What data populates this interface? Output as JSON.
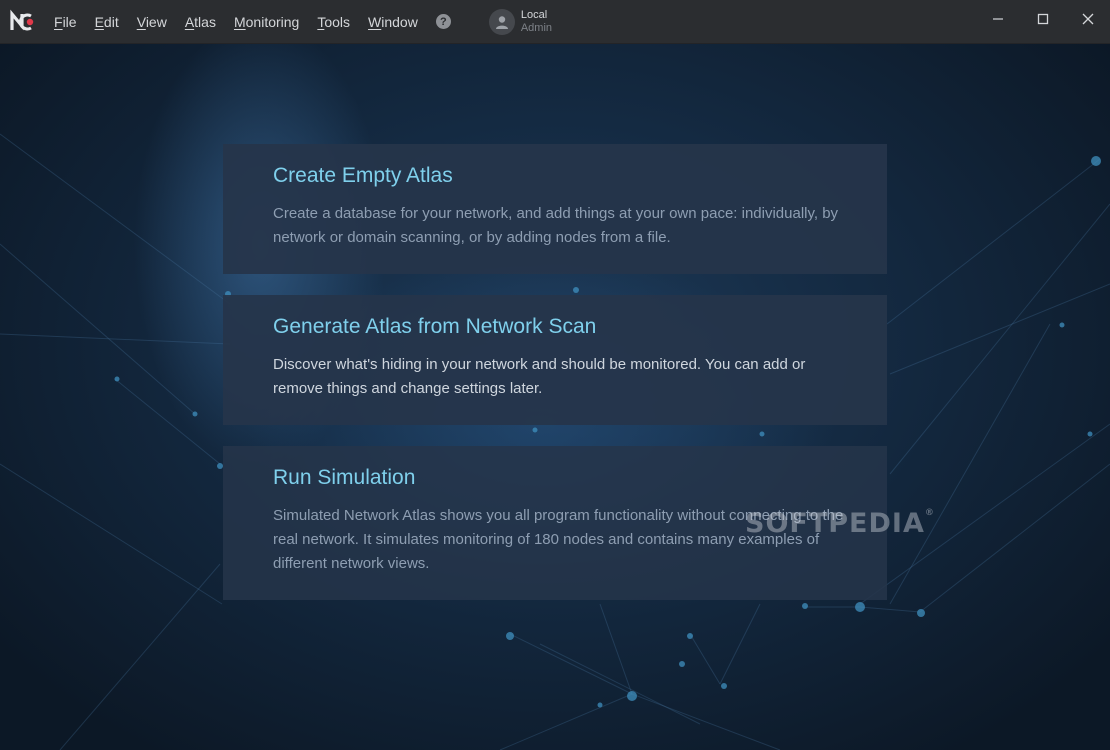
{
  "menu": {
    "items": [
      {
        "label": "File",
        "accel": "F",
        "rest": "ile"
      },
      {
        "label": "Edit",
        "accel": "E",
        "rest": "dit"
      },
      {
        "label": "View",
        "accel": "V",
        "rest": "iew"
      },
      {
        "label": "Atlas",
        "accel": "A",
        "rest": "tlas"
      },
      {
        "label": "Monitoring",
        "accel": "M",
        "rest": "onitoring"
      },
      {
        "label": "Tools",
        "accel": "T",
        "rest": "ools"
      },
      {
        "label": "Window",
        "accel": "W",
        "rest": "indow"
      }
    ],
    "help_glyph": "?"
  },
  "user": {
    "name": "Local",
    "role": "Admin"
  },
  "cards": [
    {
      "title": "Create Empty Atlas",
      "description": "Create a database for your network, and add things at your own pace: individually, by network or domain scanning, or by adding nodes from a file."
    },
    {
      "title": "Generate Atlas from Network Scan",
      "description": "Discover what's hiding in your network and should be monitored. You can add or remove things and change settings later."
    },
    {
      "title": "Run Simulation",
      "description": "Simulated Network Atlas shows you all program functionality without connecting to the real network. It simulates monitoring of 180 nodes and contains many examples of different network views."
    }
  ],
  "watermark": {
    "text": "SOFTPEDIA",
    "mark": "®"
  },
  "colors": {
    "titlebar": "#2b2d30",
    "card_title": "#7fd0ec",
    "background": "#142a42"
  },
  "icons": {
    "logo": "app-logo-icon",
    "help": "help-icon",
    "avatar": "user-avatar-icon",
    "minimize": "minimize-icon",
    "maximize": "maximize-icon",
    "close": "close-icon"
  }
}
